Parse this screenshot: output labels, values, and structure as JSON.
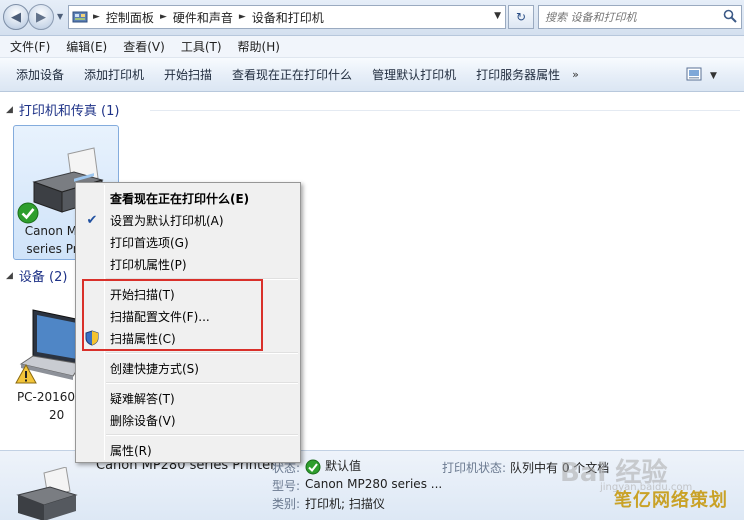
{
  "address": {
    "crumbs": [
      "控制面板",
      "硬件和声音",
      "设备和打印机"
    ],
    "search_placeholder": "搜索 设备和打印机"
  },
  "menu": [
    "文件(F)",
    "编辑(E)",
    "查看(V)",
    "工具(T)",
    "帮助(H)"
  ],
  "commands": [
    "添加设备",
    "添加打印机",
    "开始扫描",
    "查看现在正在打印什么",
    "管理默认打印机",
    "打印服务器属性"
  ],
  "commands_more": "»",
  "groups": {
    "printers_header": "打印机和传真 (1)",
    "devices_header": "设备 (2)"
  },
  "printer_device": {
    "line1": "Canon MP280",
    "line2": "series Printer",
    "status": "default"
  },
  "pc_device": {
    "line1": "PC-20160",
    "line2": "20"
  },
  "context_menu": {
    "items": [
      {
        "label": "查看现在正在打印什么(E)",
        "bold": true
      },
      {
        "label": "设置为默认打印机(A)",
        "checked": true
      },
      {
        "label": "打印首选项(G)"
      },
      {
        "label": "打印机属性(P)"
      },
      {
        "label": "开始扫描(T)"
      },
      {
        "label": "扫描配置文件(F)..."
      },
      {
        "label": "扫描属性(C)",
        "shield": true
      },
      {
        "label": "创建快捷方式(S)"
      },
      {
        "label": "疑难解答(T)"
      },
      {
        "label": "删除设备(V)"
      },
      {
        "label": "属性(R)"
      }
    ]
  },
  "details": {
    "name": "Canon MP280 series Printer",
    "status_label": "状态:",
    "status_value": "默认值",
    "model_label": "型号:",
    "model_value": "Canon MP280 series ...",
    "category_label": "类别:",
    "category_value": "打印机; 扫描仪",
    "queue_label": "打印机状态:",
    "queue_value": "队列中有 0 个文档"
  },
  "watermark": {
    "text": "Bai 经验",
    "sub": "jingyan.baidu.com",
    "brand": "笔亿网络策划"
  },
  "colors": {
    "accent": "#1e3287",
    "highlight_box": "#d9302a",
    "ok_green": "#2e9e2e"
  }
}
